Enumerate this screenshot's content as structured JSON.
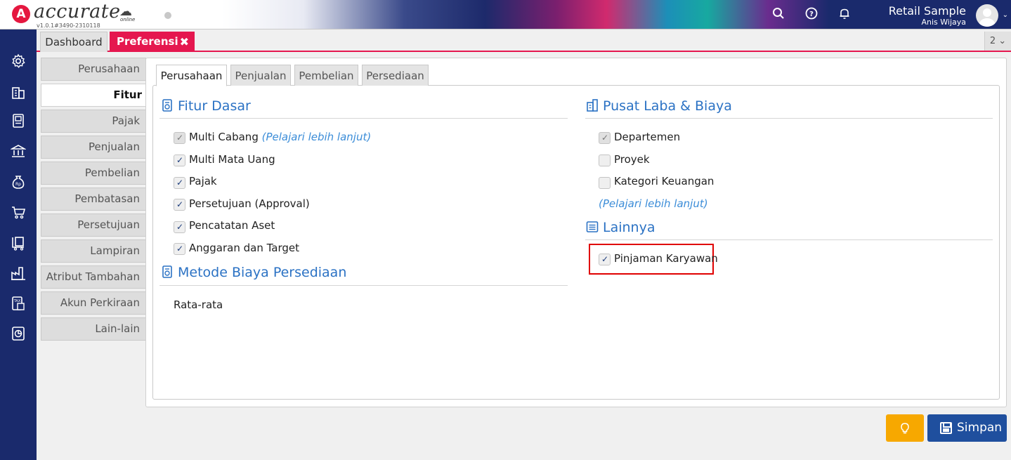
{
  "header": {
    "logo_letter": "A",
    "brand": "accurate",
    "brand_sub": "online",
    "version": "v1.0.1#3490-2310118",
    "company": "Retail Sample",
    "user": "Anis Wijaya"
  },
  "icons": {
    "search": "🔍",
    "help": "?",
    "bell": "🔔"
  },
  "tabs": {
    "dashboard": "Dashboard",
    "preferences": "Preferensi",
    "close": "✖",
    "count": "2 ⌄"
  },
  "settings_menu": [
    {
      "label": "Perusahaan",
      "active": false
    },
    {
      "label": "Fitur",
      "active": true
    },
    {
      "label": "Pajak",
      "active": false
    },
    {
      "label": "Penjualan",
      "active": false
    },
    {
      "label": "Pembelian",
      "active": false
    },
    {
      "label": "Pembatasan",
      "active": false
    },
    {
      "label": "Persetujuan",
      "active": false
    },
    {
      "label": "Lampiran",
      "active": false
    },
    {
      "label": "Atribut Tambahan",
      "active": false
    },
    {
      "label": "Akun Perkiraan",
      "active": false
    },
    {
      "label": "Lain-lain",
      "active": false
    }
  ],
  "sub_tabs": [
    "Perusahaan",
    "Penjualan",
    "Pembelian",
    "Persediaan"
  ],
  "fitur_dasar": {
    "title": "Fitur Dasar",
    "items": [
      {
        "label": "Multi Cabang",
        "checked": true,
        "disabled": true
      },
      {
        "label": "Multi Mata Uang",
        "checked": true,
        "disabled": false
      },
      {
        "label": "Pajak",
        "checked": true,
        "disabled": false
      },
      {
        "label": "Persetujuan (Approval)",
        "checked": true,
        "disabled": false
      },
      {
        "label": "Pencatatan Aset",
        "checked": true,
        "disabled": false
      },
      {
        "label": "Anggaran dan Target",
        "checked": true,
        "disabled": false
      }
    ],
    "learn_more": "(Pelajari lebih lanjut)"
  },
  "metode_biaya": {
    "title": "Metode Biaya Persediaan",
    "value": "Rata-rata"
  },
  "pusat_laba": {
    "title": "Pusat Laba & Biaya",
    "items": [
      {
        "label": "Departemen",
        "checked": true,
        "disabled": true
      },
      {
        "label": "Proyek",
        "checked": false,
        "disabled": false
      },
      {
        "label": "Kategori Keuangan",
        "checked": false,
        "disabled": false
      }
    ],
    "learn_more": "(Pelajari lebih lanjut)"
  },
  "lainnya": {
    "title": "Lainnya",
    "items": [
      {
        "label": "Pinjaman Karyawan",
        "checked": true,
        "disabled": false
      }
    ]
  },
  "buttons": {
    "bulb": "💡",
    "save": "Simpan"
  },
  "colors": {
    "accent": "#e5174f",
    "nav": "#1a2a6c",
    "link": "#2b72c4",
    "save": "#1f4f9e",
    "tip": "#f7a800",
    "highlight": "#e00000"
  }
}
